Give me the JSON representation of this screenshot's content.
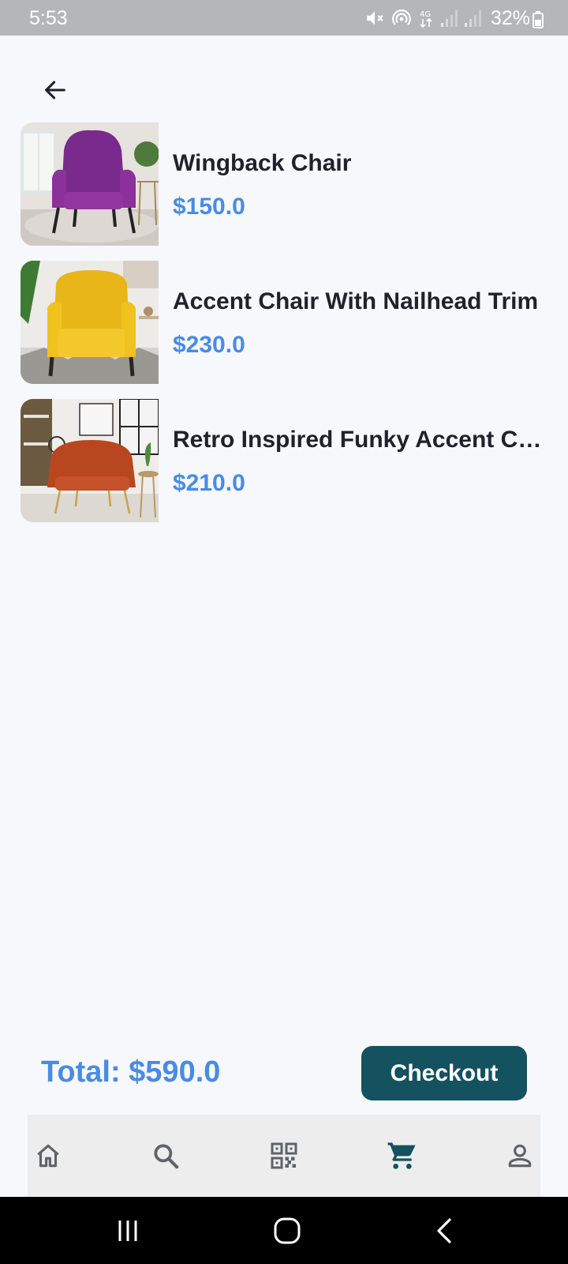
{
  "status_bar": {
    "time": "5:53",
    "battery": "32%"
  },
  "cart": {
    "items": [
      {
        "name": "Wingback Chair",
        "price": "$150.0"
      },
      {
        "name": "Accent Chair With Nailhead Trim",
        "price": "$230.0"
      },
      {
        "name": "Retro Inspired Funky Accent Ch...",
        "price": "$210.0"
      }
    ],
    "total": "Total: $590.0",
    "checkout_label": "Checkout"
  },
  "bottom_nav": {
    "items": [
      {
        "icon": "home-icon",
        "active": false
      },
      {
        "icon": "search-icon",
        "active": false
      },
      {
        "icon": "qr-code-icon",
        "active": false
      },
      {
        "icon": "cart-icon",
        "active": true
      },
      {
        "icon": "profile-icon",
        "active": false
      }
    ]
  },
  "colors": {
    "accent": "#4a8be3",
    "primary": "#13525e",
    "background": "#f6f8fc"
  }
}
